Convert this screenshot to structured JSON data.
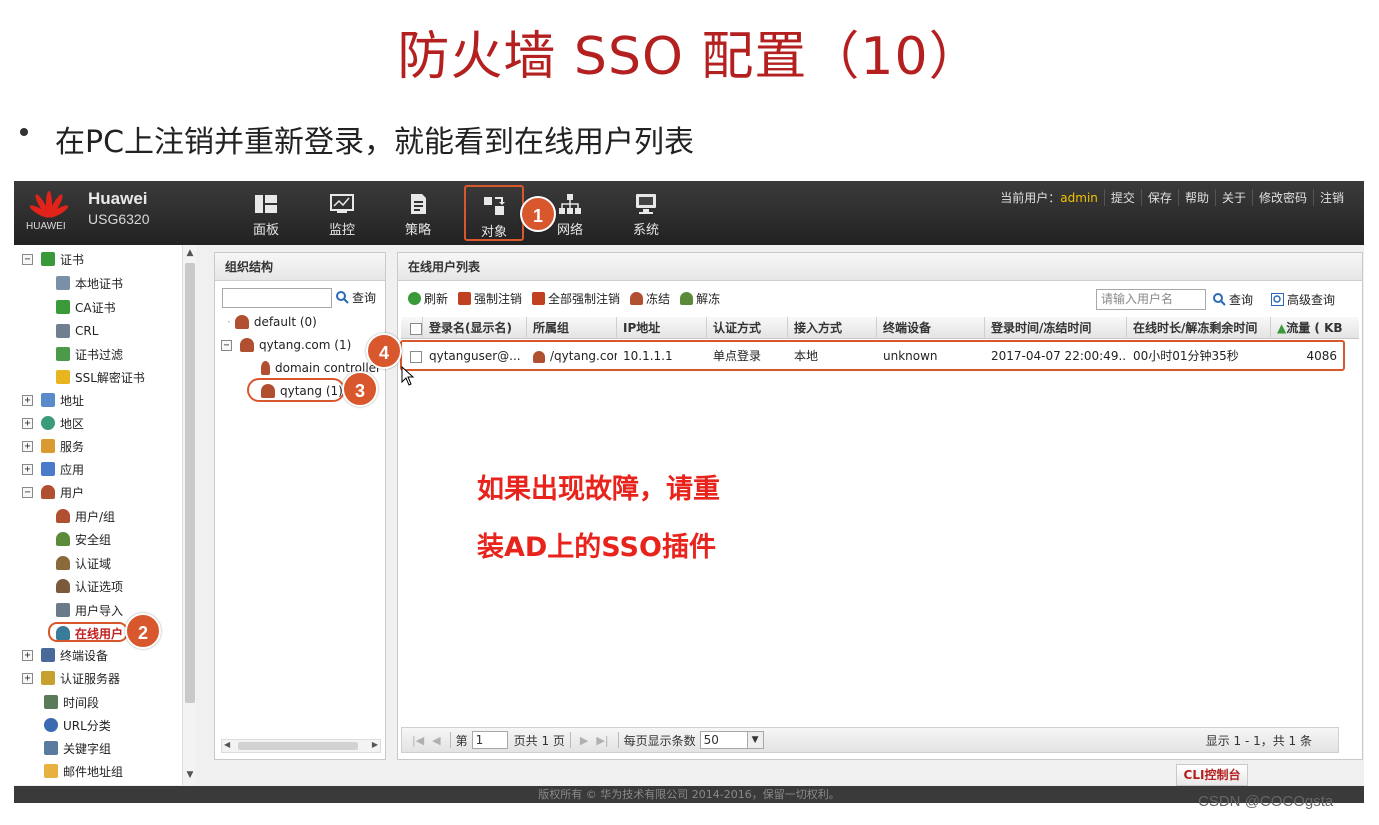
{
  "slide": {
    "title": "防火墙 SSO 配置（10）",
    "bullet": "在PC上注销并重新登录，就能看到在线用户列表"
  },
  "app": {
    "brand": "Huawei",
    "model": "USG6320",
    "logo_text": "HUAWEI",
    "nav": [
      {
        "label": "面板",
        "icon": "dashboard-icon"
      },
      {
        "label": "监控",
        "icon": "monitor-icon"
      },
      {
        "label": "策略",
        "icon": "policy-icon"
      },
      {
        "label": "对象",
        "icon": "object-icon",
        "active": true
      },
      {
        "label": "网络",
        "icon": "network-icon"
      },
      {
        "label": "系统",
        "icon": "system-icon"
      }
    ],
    "top_links": {
      "current_user_label": "当前用户：",
      "current_user": "admin",
      "submit": "提交",
      "save": "保存",
      "help": "帮助",
      "about": "关于",
      "change_password": "修改密码",
      "logout": "注销"
    }
  },
  "left_tree": {
    "items": [
      {
        "label": "证书",
        "expander": "−"
      },
      {
        "label": "本地证书"
      },
      {
        "label": "CA证书"
      },
      {
        "label": "CRL"
      },
      {
        "label": "证书过滤"
      },
      {
        "label": "SSL解密证书"
      },
      {
        "label": "地址",
        "expander": "+"
      },
      {
        "label": "地区",
        "expander": "+"
      },
      {
        "label": "服务",
        "expander": "+"
      },
      {
        "label": "应用",
        "expander": "+"
      },
      {
        "label": "用户",
        "expander": "−"
      },
      {
        "label": "用户/组"
      },
      {
        "label": "安全组"
      },
      {
        "label": "认证域"
      },
      {
        "label": "认证选项"
      },
      {
        "label": "用户导入"
      },
      {
        "label": "在线用户",
        "selected": true
      },
      {
        "label": "终端设备",
        "expander": "+"
      },
      {
        "label": "认证服务器",
        "expander": "+"
      },
      {
        "label": "时间段"
      },
      {
        "label": "URL分类"
      },
      {
        "label": "关键字组"
      },
      {
        "label": "邮件地址组"
      }
    ]
  },
  "org_panel": {
    "title": "组织结构",
    "search_button": "查询",
    "items": [
      {
        "label": "default (0)"
      },
      {
        "label": "qytang.com (1)",
        "expander": "−"
      },
      {
        "label": "domain controller"
      },
      {
        "label": "qytang (1)"
      }
    ]
  },
  "main_panel": {
    "title": "在线用户列表",
    "toolbar": {
      "refresh": "刷新",
      "force_logout": "强制注销",
      "force_logout_all": "全部强制注销",
      "freeze": "冻结",
      "unfreeze": "解冻",
      "search_placeholder": "请输入用户名",
      "search": "查询",
      "advanced_search": "高级查询"
    },
    "columns": [
      "登录名(显示名)",
      "所属组",
      "IP地址",
      "认证方式",
      "接入方式",
      "终端设备",
      "登录时间/冻结时间",
      "在线时长/解冻剩余时间",
      "流量 ( KB"
    ],
    "rows": [
      {
        "login": "qytanguser@...",
        "group": "/qytang.com...",
        "ip": "10.1.1.1",
        "auth": "单点登录",
        "access": "本地",
        "device": "unknown",
        "login_time": "2017-04-07 22:00:49...",
        "online_duration": "00小时01分钟35秒",
        "traffic": "4086"
      }
    ],
    "pager": {
      "page_label": "第",
      "page_value": "1",
      "page_total": "页共 1 页",
      "per_page_label": "每页显示条数",
      "per_page_value": "50",
      "summary": "显示 1 - 1，共 1 条"
    }
  },
  "cli_tab": "CLI控制台",
  "footer": "版权所有 © 华为技术有限公司 2014-2016，保留一切权利。",
  "annotation_note": [
    "如果出现故障，请重",
    "装AD上的SSO插件"
  ],
  "step_badges": [
    "1",
    "2",
    "3",
    "4"
  ],
  "watermark": "CSDN @COCOgsta",
  "colors": {
    "title_red": "#b41f1f",
    "note_red": "#e8231c",
    "badge_orange": "#d9572c",
    "admin_yellow": "#f3c200",
    "topbar_dark": "#2a2a2a"
  }
}
